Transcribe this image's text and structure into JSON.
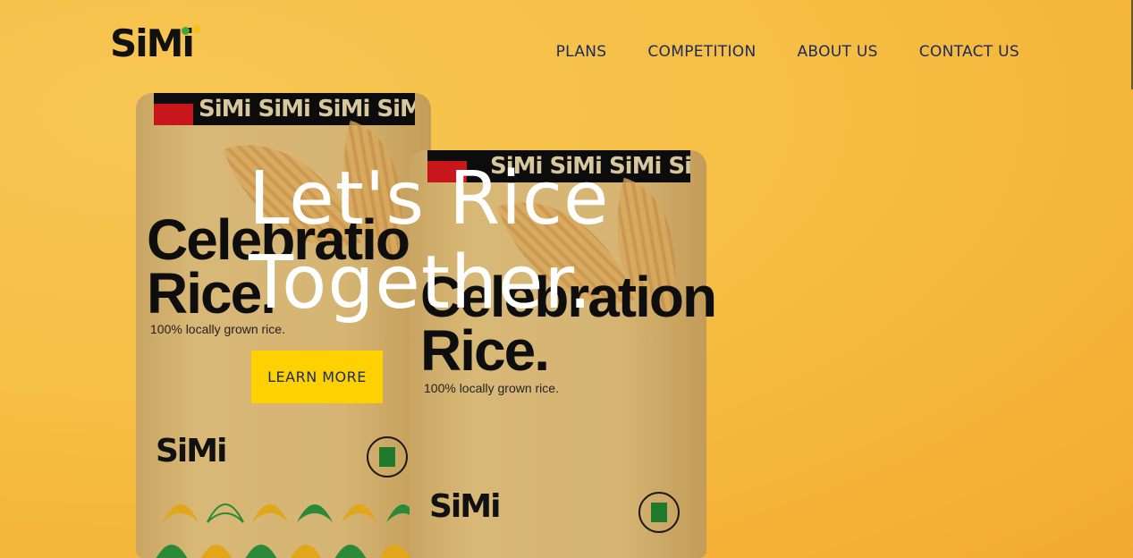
{
  "brand": {
    "logo_text": "SiMi",
    "colors": {
      "dot_green": "#3aa83a",
      "dot_yellow": "#f2c21a"
    }
  },
  "nav": {
    "items": [
      {
        "label": "PLANS"
      },
      {
        "label": "COMPETITION"
      },
      {
        "label": "ABOUT US"
      },
      {
        "label": "CONTACT US"
      }
    ]
  },
  "hero": {
    "title_line1": "Let's Rice",
    "title_line2": "Together.",
    "cta_label": "LEARN MORE"
  },
  "bags": [
    {
      "band_text": "SiMi SiMi SiMi SiMi",
      "name_line1": "Celebration",
      "name_line2": "Rice.",
      "tagline": "100% locally grown rice.",
      "logo_text": "SiMi"
    },
    {
      "band_text": "SiMi SiMi SiMi SiMi",
      "name_line1": "Celebration",
      "name_line2": "Rice.",
      "tagline": "100% locally grown rice.",
      "logo_text": "SiMi"
    }
  ],
  "colors": {
    "background": "#f6bf45",
    "nav_text": "#1a2a5c",
    "cta_bg": "#ffd100",
    "bag_band": "#0c0c0c",
    "bag_red": "#c8161d"
  }
}
